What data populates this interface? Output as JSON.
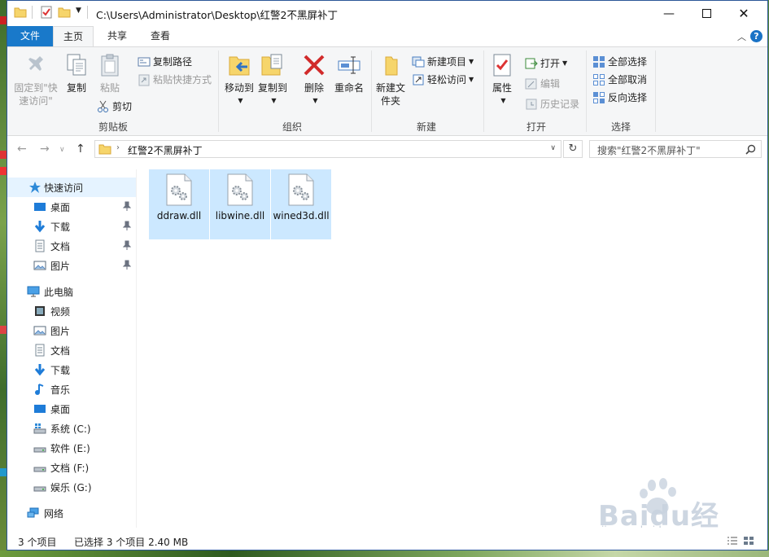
{
  "window": {
    "path_title": "C:\\Users\\Administrator\\Desktop\\红警2不黑屏补丁"
  },
  "tabs": [
    "文件",
    "主页",
    "共享",
    "查看"
  ],
  "ribbon": {
    "clipboard": {
      "label": "剪贴板",
      "pin": "固定到\"快速访问\"",
      "copy": "复制",
      "paste": "粘贴",
      "copy_path": "复制路径",
      "paste_shortcut": "粘贴快捷方式",
      "cut": "剪切"
    },
    "organize": {
      "label": "组织",
      "move_to": "移动到",
      "copy_to": "复制到",
      "delete": "删除",
      "rename": "重命名"
    },
    "new": {
      "label": "新建",
      "new_folder": "新建文件夹",
      "new_item": "新建项目",
      "easy_access": "轻松访问"
    },
    "open": {
      "label": "打开",
      "properties": "属性",
      "open": "打开",
      "edit": "编辑",
      "history": "历史记录"
    },
    "select": {
      "label": "选择",
      "select_all": "全部选择",
      "select_none": "全部取消",
      "invert": "反向选择"
    }
  },
  "address": {
    "crumb": "红警2不黑屏补丁",
    "search_placeholder": "搜索\"红警2不黑屏补丁\""
  },
  "nav": {
    "quick_access": "快速访问",
    "quick_items": [
      "桌面",
      "下载",
      "文档",
      "图片"
    ],
    "this_pc": "此电脑",
    "pc_items": [
      "视频",
      "图片",
      "文档",
      "下载",
      "音乐",
      "桌面",
      "系统 (C:)",
      "软件 (E:)",
      "文档 (F:)",
      "娱乐 (G:)"
    ],
    "network": "网络"
  },
  "files": [
    "ddraw.dll",
    "libwine.dll",
    "wined3d.dll"
  ],
  "status": {
    "count": "3 个项目",
    "selected": "已选择 3 个项目  2.40 MB"
  },
  "watermark": {
    "text": "Baidu经验",
    "url": "jingyan.baidu.com"
  },
  "colors": {
    "accent": "#1979ca",
    "selection": "#cce8ff",
    "ribbon_bg": "#f5f6f7"
  }
}
